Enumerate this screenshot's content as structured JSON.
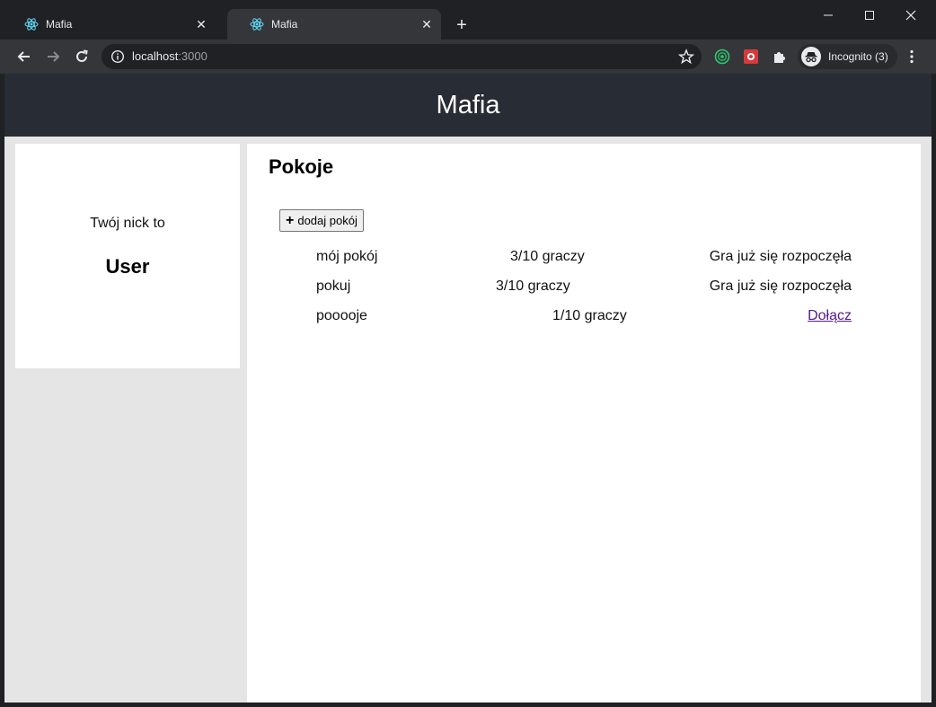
{
  "browser": {
    "tabs": [
      {
        "title": "Mafia",
        "active": false
      },
      {
        "title": "Mafia",
        "active": true
      }
    ],
    "url_host": "localhost",
    "url_port": ":3000",
    "profile_label": "Incognito (3)"
  },
  "app": {
    "header_title": "Mafia"
  },
  "sidebar": {
    "nick_label": "Twój nick to",
    "nick_value": "User"
  },
  "main": {
    "title": "Pokoje",
    "add_room_label": "dodaj pokój",
    "rooms": [
      {
        "name": "mój pokój",
        "players": "3/10 graczy",
        "status": "Gra już się rozpoczęła"
      },
      {
        "name": "pokuj",
        "players": "3/10 graczy",
        "status": "Gra już się rozpoczęła"
      },
      {
        "name": "pooooje",
        "players": "1/10 graczy",
        "action": "Dołącz"
      }
    ]
  },
  "colors": {
    "header_bg": "#282c34",
    "page_bg": "#e5e5e5",
    "link_visited": "#551a8b"
  }
}
